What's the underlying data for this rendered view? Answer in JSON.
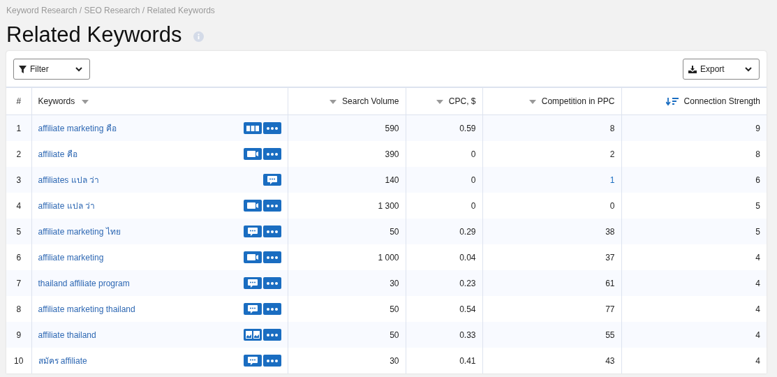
{
  "breadcrumb": "Keyword Research / SEO Research / Related Keywords",
  "title": "Related Keywords",
  "toolbar": {
    "filter": "Filter",
    "export": "Export"
  },
  "columns": [
    {
      "label": "#",
      "kind": "index",
      "sortable": false
    },
    {
      "label": "Keywords",
      "kind": "text",
      "sortable": true,
      "sorted": false
    },
    {
      "label": "Search Volume",
      "kind": "number",
      "sortable": true,
      "sorted": false
    },
    {
      "label": "CPC, $",
      "kind": "number",
      "sortable": true,
      "sorted": false
    },
    {
      "label": "Competition in PPC",
      "kind": "number",
      "sortable": true,
      "sorted": false
    },
    {
      "label": "Connection Strength",
      "kind": "number",
      "sortable": true,
      "sorted": true
    }
  ],
  "rows": [
    {
      "n": "1",
      "keyword": "affiliate marketing คือ",
      "kind": "columns",
      "more": true,
      "volume": "590",
      "cpc": "0.59",
      "competition": "8",
      "competition_highlighted": false,
      "strength": "9"
    },
    {
      "n": "2",
      "keyword": "affiliate คือ",
      "kind": "video",
      "more": true,
      "volume": "390",
      "cpc": "0",
      "competition": "2",
      "competition_highlighted": false,
      "strength": "8"
    },
    {
      "n": "3",
      "keyword": "affiliates แปล ว่า",
      "kind": "chat",
      "more": false,
      "volume": "140",
      "cpc": "0",
      "competition": "1",
      "competition_highlighted": true,
      "strength": "6"
    },
    {
      "n": "4",
      "keyword": "affiliate แปล ว่า",
      "kind": "video",
      "more": true,
      "volume": "1 300",
      "cpc": "0",
      "competition": "0",
      "competition_highlighted": false,
      "strength": "5"
    },
    {
      "n": "5",
      "keyword": "affiliate marketing ไทย",
      "kind": "chat",
      "more": true,
      "volume": "50",
      "cpc": "0.29",
      "competition": "38",
      "competition_highlighted": false,
      "strength": "5"
    },
    {
      "n": "6",
      "keyword": "affiliate marketing",
      "kind": "video",
      "more": true,
      "volume": "1 000",
      "cpc": "0.04",
      "competition": "37",
      "competition_highlighted": false,
      "strength": "4"
    },
    {
      "n": "7",
      "keyword": "thailand affiliate program",
      "kind": "chat",
      "more": true,
      "volume": "30",
      "cpc": "0.23",
      "competition": "61",
      "competition_highlighted": false,
      "strength": "4"
    },
    {
      "n": "8",
      "keyword": "affiliate marketing thailand",
      "kind": "chat",
      "more": true,
      "volume": "50",
      "cpc": "0.54",
      "competition": "77",
      "competition_highlighted": false,
      "strength": "4"
    },
    {
      "n": "9",
      "keyword": "affiliate thailand",
      "kind": "images",
      "more": true,
      "volume": "50",
      "cpc": "0.33",
      "competition": "55",
      "competition_highlighted": false,
      "strength": "4"
    },
    {
      "n": "10",
      "keyword": "สมัคร affiliate",
      "kind": "chat",
      "more": true,
      "volume": "30",
      "cpc": "0.41",
      "competition": "43",
      "competition_highlighted": false,
      "strength": "4"
    }
  ]
}
